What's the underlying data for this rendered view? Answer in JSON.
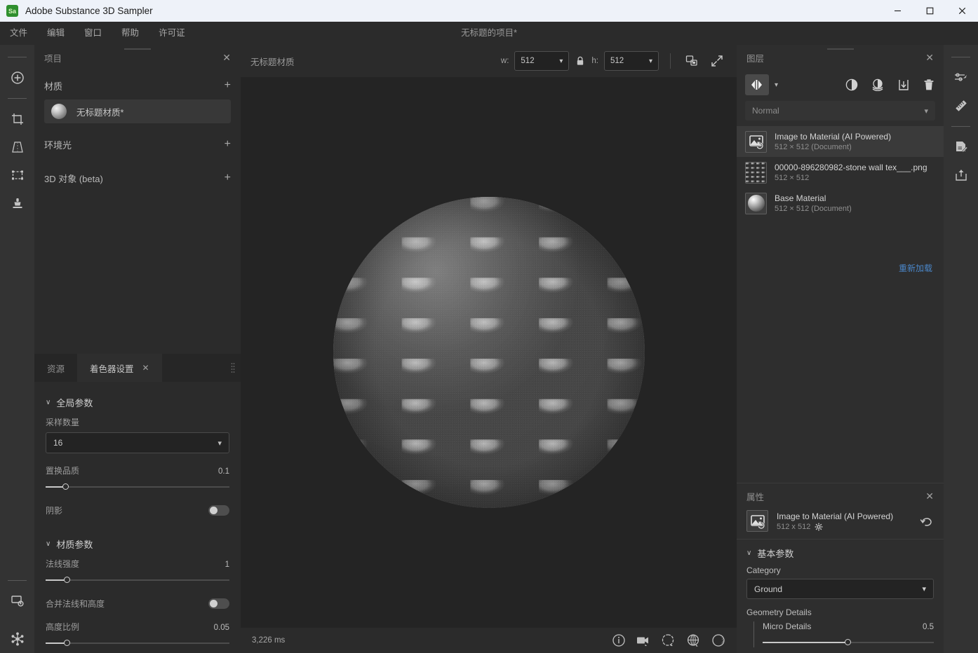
{
  "window": {
    "app_title": "Adobe Substance 3D Sampler",
    "logo_text": "Sa",
    "minimize": "—",
    "maximize": "☐",
    "close": "✕"
  },
  "menubar": {
    "items": [
      "文件",
      "编辑",
      "窗口",
      "帮助",
      "许可证"
    ],
    "document_title": "无标题的项目*"
  },
  "left_rail": {
    "tools": [
      {
        "name": "add-tool",
        "icon": "plus-circle-icon"
      },
      {
        "name": "crop-tool",
        "icon": "crop-icon"
      },
      {
        "name": "perspective-tool",
        "icon": "perspective-icon"
      },
      {
        "name": "transform-tool",
        "icon": "transform-icon"
      },
      {
        "name": "clone-stamp-tool",
        "icon": "stamp-icon"
      },
      {
        "name": "render-settings-tool",
        "icon": "screen-gear-icon"
      },
      {
        "name": "graph-tool",
        "icon": "node-graph-icon"
      }
    ]
  },
  "right_rail": {
    "tools": [
      {
        "name": "parameters-tool",
        "icon": "sliders-pin-icon"
      },
      {
        "name": "measure-tool",
        "icon": "ruler-icon"
      },
      {
        "name": "notes-tool",
        "icon": "document-edit-icon"
      },
      {
        "name": "export-tool",
        "icon": "export-up-icon"
      }
    ]
  },
  "project_panel": {
    "title": "项目",
    "close": "✕",
    "sections": [
      {
        "label": "材质",
        "add": "+"
      },
      {
        "label": "环境光",
        "add": "+"
      },
      {
        "label": "3D 对象 (beta)",
        "add": "+"
      }
    ],
    "material_item": "无标题材质*"
  },
  "shader_panel": {
    "tabs": [
      {
        "label": "资源",
        "active": false,
        "closable": false
      },
      {
        "label": "着色器设置",
        "active": true,
        "closable": true,
        "close": "✕"
      }
    ],
    "groups": [
      {
        "title": "全局参数",
        "chevron": "∨",
        "sample_count_label": "采样数量",
        "sample_count_value": "16",
        "displacement_label": "置换品质",
        "displacement_value": "0.1",
        "displacement_pct": 11,
        "shadow_label": "阴影",
        "shadow_on": false
      },
      {
        "title": "材质参数",
        "chevron": "∨",
        "normal_label": "法线强度",
        "normal_value": "1",
        "normal_pct": 12,
        "merge_label": "合并法线和高度",
        "merge_on": false,
        "height_label": "高度比例",
        "height_value": "0.05",
        "height_pct": 12
      }
    ]
  },
  "viewport": {
    "title": "无标题材质",
    "width_label": "w:",
    "width_value": "512",
    "lock_icon": "lock-icon",
    "height_label": "h:",
    "height_value": "512",
    "compare_icon": "compare-icon",
    "fullscreen_icon": "expand-icon",
    "render_time": "3,226 ms",
    "bottom_icons": [
      "info-icon",
      "camera-icon",
      "environment-icon",
      "globe-icon",
      "material-sphere-icon"
    ]
  },
  "layers_panel": {
    "title": "图层",
    "close": "✕",
    "blend_mode": "Normal",
    "toolbar_icons": [
      "split-view-icon",
      "chevron-down-icon",
      "adjustment-icon",
      "filter-icon",
      "import-icon",
      "delete-icon"
    ],
    "reload_label": "重新加载",
    "layers": [
      {
        "name": "Image to Material (AI Powered)",
        "sub": "512 × 512 (Document)",
        "thumb": "image-to-material-icon",
        "selected": true
      },
      {
        "name": "00000-896280982-stone wall tex___.png",
        "sub": "512 × 512",
        "thumb": "stone-texture-thumb",
        "selected": false
      },
      {
        "name": "Base Material",
        "sub": "512 × 512 (Document)",
        "thumb": "sphere-thumb",
        "selected": false
      }
    ]
  },
  "properties_panel": {
    "title": "属性",
    "close": "✕",
    "object_name": "Image to Material (AI Powered)",
    "object_sub": "512 x 512",
    "gear_icon": "gear-icon",
    "reset_icon": "reset-icon",
    "group_title": "基本参数",
    "group_chevron": "∨",
    "category_label": "Category",
    "category_value": "Ground",
    "geometry_label": "Geometry Details",
    "micro_details_label": "Micro Details",
    "micro_details_value": "0.5",
    "micro_details_pct": 50
  }
}
